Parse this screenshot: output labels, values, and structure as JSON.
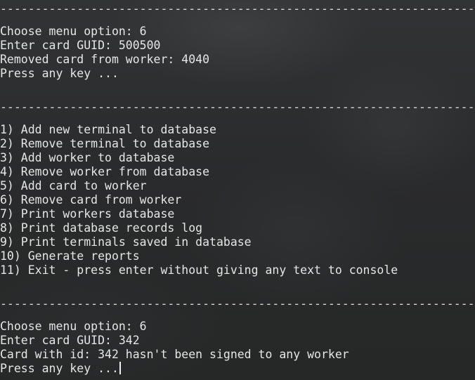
{
  "terminal": {
    "separator": "-----------------------------------------------------------------------------------",
    "block1": {
      "l1": "Choose menu option: 6",
      "l2": "Enter card GUID: 500500",
      "l3": "Removed card from worker: 4040",
      "l4": "Press any key ..."
    },
    "menu": [
      "1) Add new terminal to database",
      "2) Remove terminal to database",
      "3) Add worker to database",
      "4) Remove worker from database",
      "5) Add card to worker",
      "6) Remove card from worker",
      "7) Print workers database",
      "8) Print database records log",
      "9) Print terminals saved in database",
      "10) Generate reports",
      "11) Exit - press enter without giving any text to console"
    ],
    "block2": {
      "l1": "Choose menu option: 6",
      "l2": "Enter card GUID: 342",
      "l3": "Card with id: 342 hasn't been signed to any worker",
      "l4": "Press any key ..."
    }
  }
}
